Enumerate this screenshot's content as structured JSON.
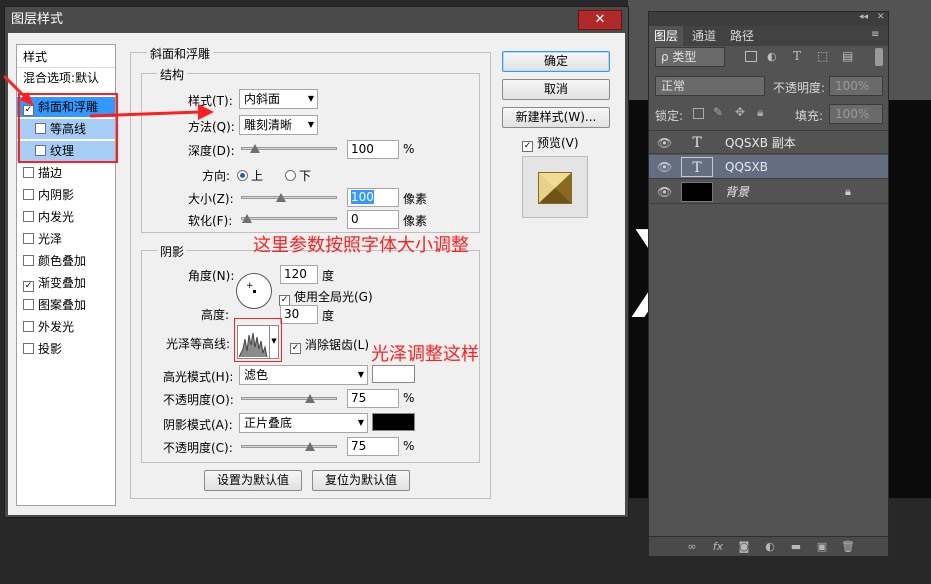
{
  "dialog": {
    "title": "图层样式",
    "close": "✕"
  },
  "style_list": {
    "header": "样式",
    "blend_options": "混合选项:默认",
    "items": [
      {
        "label": "斜面和浮雕",
        "checked": true
      },
      {
        "label": "等高线",
        "checked": false
      },
      {
        "label": "纹理",
        "checked": false
      },
      {
        "label": "描边",
        "checked": false
      },
      {
        "label": "内阴影",
        "checked": false
      },
      {
        "label": "内发光",
        "checked": false
      },
      {
        "label": "光泽",
        "checked": false
      },
      {
        "label": "颜色叠加",
        "checked": false
      },
      {
        "label": "渐变叠加",
        "checked": true
      },
      {
        "label": "图案叠加",
        "checked": false
      },
      {
        "label": "外发光",
        "checked": false
      },
      {
        "label": "投影",
        "checked": false
      }
    ]
  },
  "bevel": {
    "group_title": "斜面和浮雕",
    "structure_title": "结构",
    "style_label": "样式(T):",
    "style_value": "内斜面",
    "technique_label": "方法(Q):",
    "technique_value": "雕刻清晰",
    "depth_label": "深度(D):",
    "depth_value": "100",
    "depth_unit": "%",
    "depth_level": 0.1,
    "direction_label": "方向:",
    "dir_up": "上",
    "dir_down": "下",
    "size_label": "大小(Z):",
    "size_value": "100",
    "size_unit": "像素",
    "size_level": 0.4,
    "soften_label": "软化(F):",
    "soften_value": "0",
    "soften_unit": "像素",
    "soften_level": 0.0,
    "shading_title": "阴影",
    "angle_label": "角度(N):",
    "angle_value": "120",
    "angle_unit": "度",
    "global_light": "使用全局光(G)",
    "altitude_label": "高度:",
    "altitude_value": "30",
    "altitude_unit": "度",
    "gloss_contour_label": "光泽等高线:",
    "antialias": "消除锯齿(L)",
    "highlight_mode_label": "高光模式(H):",
    "highlight_mode_value": "滤色",
    "highlight_color": "#ffffff",
    "highlight_opacity_label": "不透明度(O):",
    "highlight_opacity_value": "75",
    "highlight_opacity_unit": "%",
    "highlight_opacity_level": 0.75,
    "shadow_mode_label": "阴影模式(A):",
    "shadow_mode_value": "正片叠底",
    "shadow_color": "#000000",
    "shadow_opacity_label": "不透明度(C):",
    "shadow_opacity_value": "75",
    "shadow_opacity_unit": "%",
    "shadow_opacity_level": 0.75,
    "make_default": "设置为默认值",
    "reset_default": "复位为默认值"
  },
  "buttons": {
    "ok": "确定",
    "cancel": "取消",
    "new_style": "新建样式(W)...",
    "preview": "预览(V)"
  },
  "annotations": {
    "note1": "这里参数按照字体大小调整",
    "note2": "光泽调整这样"
  },
  "layers_panel": {
    "tabs": [
      "图层",
      "通道",
      "路径"
    ],
    "filter_kind": "ρ 类型",
    "blend_mode": "正常",
    "opacity_label": "不透明度:",
    "opacity_value": "100%",
    "lock_label": "锁定:",
    "fill_label": "填充:",
    "fill_value": "100%",
    "layers": [
      {
        "name": "QQSXB 副本",
        "type": "text",
        "selected": false
      },
      {
        "name": "QQSXB",
        "type": "text",
        "selected": true
      },
      {
        "name": "背景",
        "type": "background",
        "selected": false
      }
    ]
  }
}
